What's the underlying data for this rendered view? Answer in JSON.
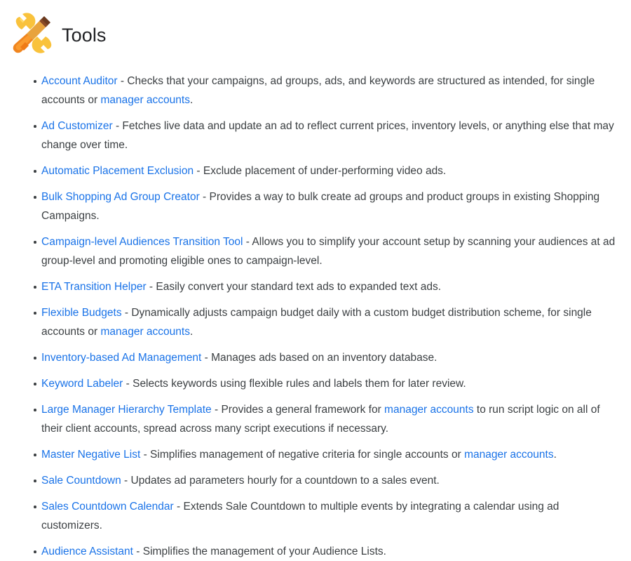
{
  "header": {
    "icon": "tools-emoji",
    "title": "Tools"
  },
  "colors": {
    "link": "#1a73e8",
    "text": "#3c4043",
    "title": "#202124",
    "background": "#ffffff"
  },
  "manager_accounts_label": "manager accounts",
  "separator": " - ",
  "items": [
    {
      "link": "Account Auditor",
      "parts": [
        {
          "type": "text",
          "value": " - Checks that your campaigns, ad groups, ads, and keywords are structured as intended, for single accounts or "
        },
        {
          "type": "link",
          "value": "manager accounts"
        },
        {
          "type": "text",
          "value": "."
        }
      ]
    },
    {
      "link": "Ad Customizer",
      "parts": [
        {
          "type": "text",
          "value": " - Fetches live data and update an ad to reflect current prices, inventory levels, or anything else that may change over time."
        }
      ]
    },
    {
      "link": "Automatic Placement Exclusion",
      "parts": [
        {
          "type": "text",
          "value": " - Exclude placement of under-performing video ads."
        }
      ]
    },
    {
      "link": "Bulk Shopping Ad Group Creator",
      "parts": [
        {
          "type": "text",
          "value": " - Provides a way to bulk create ad groups and product groups in existing Shopping Campaigns."
        }
      ]
    },
    {
      "link": "Campaign-level Audiences Transition Tool",
      "parts": [
        {
          "type": "text",
          "value": " - Allows you to simplify your account setup by scanning your audiences at ad group-level and promoting eligible ones to campaign-level."
        }
      ]
    },
    {
      "link": "ETA Transition Helper",
      "parts": [
        {
          "type": "text",
          "value": " - Easily convert your standard text ads to expanded text ads."
        }
      ]
    },
    {
      "link": "Flexible Budgets",
      "parts": [
        {
          "type": "text",
          "value": " - Dynamically adjusts campaign budget daily with a custom budget distribution scheme, for single accounts or "
        },
        {
          "type": "link",
          "value": "manager accounts"
        },
        {
          "type": "text",
          "value": "."
        }
      ]
    },
    {
      "link": "Inventory-based Ad Management",
      "parts": [
        {
          "type": "text",
          "value": " - Manages ads based on an inventory database."
        }
      ]
    },
    {
      "link": "Keyword Labeler",
      "parts": [
        {
          "type": "text",
          "value": " - Selects keywords using flexible rules and labels them for later review."
        }
      ]
    },
    {
      "link": "Large Manager Hierarchy Template",
      "parts": [
        {
          "type": "text",
          "value": " - Provides a general framework for "
        },
        {
          "type": "link",
          "value": "manager accounts"
        },
        {
          "type": "text",
          "value": " to run script logic on all of their client accounts, spread across many script executions if necessary."
        }
      ]
    },
    {
      "link": "Master Negative List",
      "parts": [
        {
          "type": "text",
          "value": " - Simplifies management of negative criteria for single accounts or "
        },
        {
          "type": "link",
          "value": "manager accounts"
        },
        {
          "type": "text",
          "value": "."
        }
      ]
    },
    {
      "link": "Sale Countdown",
      "parts": [
        {
          "type": "text",
          "value": " - Updates ad parameters hourly for a countdown to a sales event."
        }
      ]
    },
    {
      "link": "Sales Countdown Calendar",
      "parts": [
        {
          "type": "text",
          "value": " - Extends Sale Countdown to multiple events by integrating a calendar using ad customizers."
        }
      ]
    },
    {
      "link": "Audience Assistant",
      "parts": [
        {
          "type": "text",
          "value": " - Simplifies the management of your Audience Lists."
        }
      ]
    }
  ]
}
